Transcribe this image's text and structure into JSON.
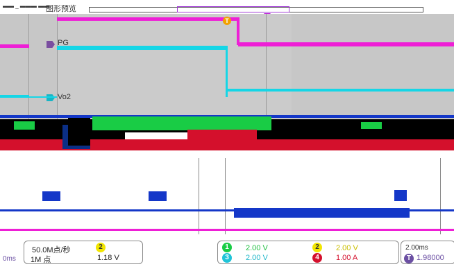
{
  "header": {
    "left_label": "▬▬ _  ▬▬▬ ▬▬",
    "title": "图形预览"
  },
  "traces": {
    "pg_label": "PG",
    "vo2_label": "Vo2",
    "marker_badge": "T"
  },
  "status": {
    "sample_rate": "50.0M点/秒",
    "record_length": "1M 点",
    "left_unit": "0ms",
    "ch2_level": "1.18 V",
    "ch1_scale": "2.00 V",
    "ch3_scale": "2.00 V",
    "ch2_scale": "2.00 V",
    "ch4_scale": "1.00 A",
    "time_label": "2.00ms",
    "trigger_value": "1.98000",
    "ch1_badge": "1",
    "ch2_badge": "2",
    "ch3_badge": "3",
    "ch4_badge": "4",
    "trig_badge": "T"
  },
  "colors": {
    "ch1": "#19cc45",
    "ch2": "#f7e600",
    "ch3": "#20d0e0",
    "ch4": "#d4102c",
    "magenta": "#ee1fd6",
    "cyan": "#15d6e6",
    "grid_bg": "#c8c8c8",
    "blue": "#1437c8"
  }
}
